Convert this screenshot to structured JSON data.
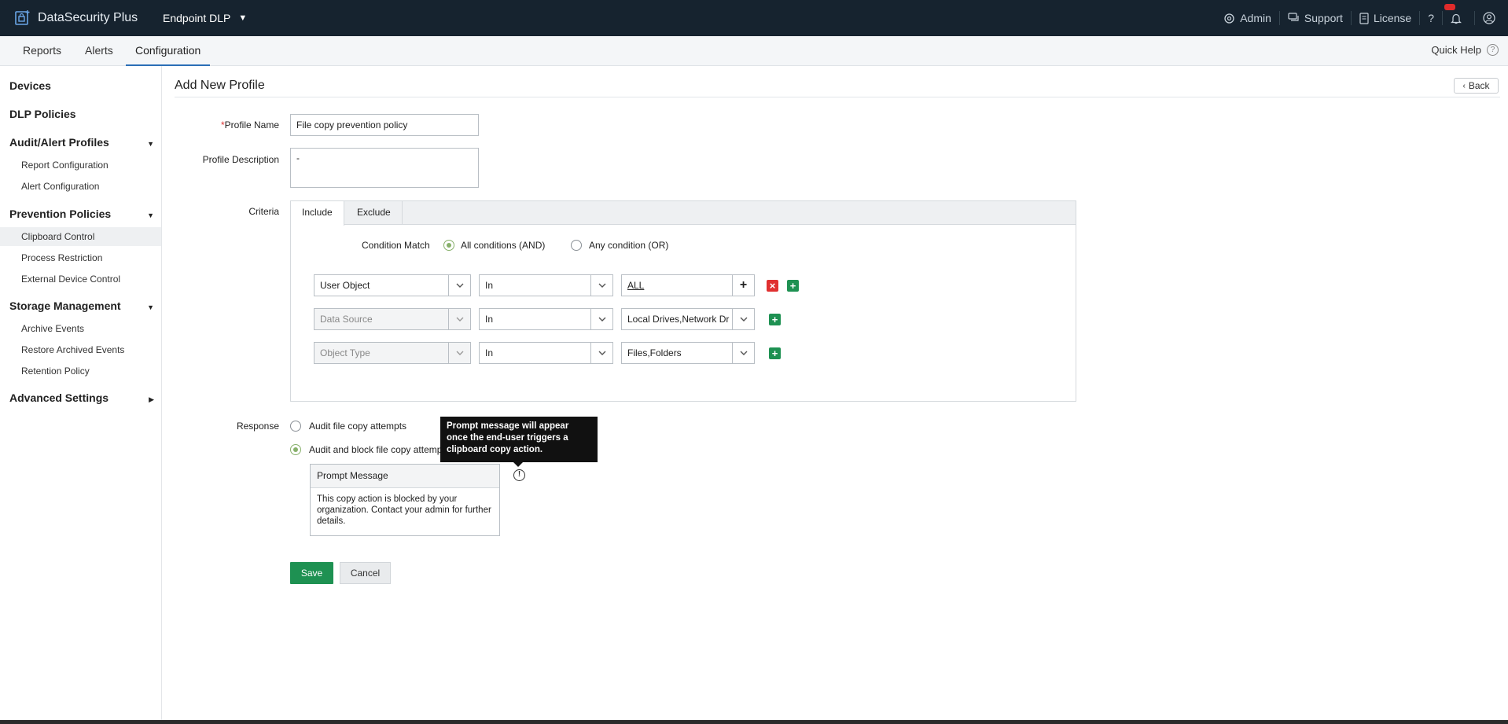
{
  "app": {
    "brand": "DataSecurity Plus",
    "module": "Endpoint DLP"
  },
  "topbar": {
    "admin": "Admin",
    "support": "Support",
    "license": "License",
    "help": "?"
  },
  "subnav": {
    "tabs": [
      "Reports",
      "Alerts",
      "Configuration"
    ],
    "active": "Configuration",
    "quick_help": "Quick Help",
    "quick_help_icon": "?"
  },
  "sidebar": {
    "devices": "Devices",
    "dlp_policies": "DLP Policies",
    "audit_alert_profiles": "Audit/Alert Profiles",
    "report_configuration": "Report Configuration",
    "alert_configuration": "Alert Configuration",
    "prevention_policies": "Prevention Policies",
    "clipboard_control": "Clipboard Control",
    "process_restriction": "Process Restriction",
    "external_device_control": "External Device Control",
    "storage_management": "Storage Management",
    "archive_events": "Archive Events",
    "restore_archived_events": "Restore Archived Events",
    "retention_policy": "Retention Policy",
    "advanced_settings": "Advanced Settings"
  },
  "page": {
    "title": "Add New Profile",
    "back": "Back"
  },
  "form": {
    "profile_name_label": "Profile Name",
    "required_mark": "*",
    "profile_name_value": "File copy prevention policy",
    "profile_description_label": "Profile Description",
    "profile_description_value": "-",
    "criteria_label": "Criteria",
    "tab_include": "Include",
    "tab_exclude": "Exclude",
    "condition_match_label": "Condition Match",
    "all_conditions": "All conditions (AND)",
    "any_condition": "Any condition (OR)",
    "rows": [
      {
        "field": "User Object",
        "operator": "In",
        "value": "ALL"
      },
      {
        "field": "Data Source",
        "operator": "In",
        "value": "Local Drives,Network Dr"
      },
      {
        "field": "Object Type",
        "operator": "In",
        "value": "Files,Folders"
      }
    ],
    "response_label": "Response",
    "response_audit": "Audit file copy attempts",
    "response_audit_block": "Audit and block file copy attempts",
    "tooltip": "Prompt message will appear once the end-user triggers a clipboard copy action.",
    "prompt_title": "Prompt Message",
    "prompt_text": "This copy action is blocked by your organization. Contact your admin for further details.",
    "info_icon": "!",
    "save": "Save",
    "cancel": "Cancel"
  },
  "colors": {
    "topbar": "#16232f",
    "accent": "#2a6eb6",
    "save": "#1e9152",
    "remove": "#e03030",
    "radio_on": "#87b06a"
  }
}
